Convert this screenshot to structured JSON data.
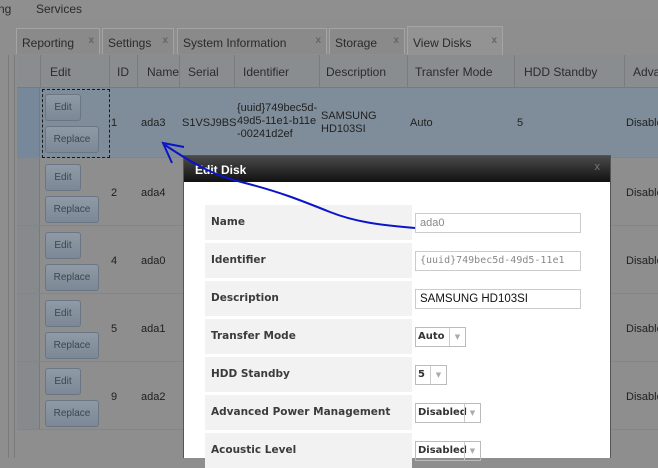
{
  "menu": {
    "partial": "ng",
    "services": "Services"
  },
  "tabs": [
    {
      "label": "Reporting"
    },
    {
      "label": "Settings"
    },
    {
      "label": "System Information"
    },
    {
      "label": "Storage"
    },
    {
      "label": "View Disks"
    }
  ],
  "tab_close": "x",
  "columns": [
    "Edit",
    "ID",
    "Name",
    "Serial",
    "Identifier",
    "Description",
    "Transfer Mode",
    "HDD Standby",
    "Advan"
  ],
  "buttons": {
    "edit": "Edit",
    "replace": "Replace"
  },
  "rows": [
    {
      "id": "1",
      "name": "ada3",
      "serial": "S1VSJ9BS",
      "identifier": "{uuid}749bec5d-49d5-11e1-b11e-00241d2ef",
      "description": "SAMSUNG HD103SI",
      "transfer": "Auto",
      "standby": "5",
      "apm": "Disabled"
    },
    {
      "id": "2",
      "name": "ada4",
      "apm": "Disabled"
    },
    {
      "id": "4",
      "name": "ada0",
      "apm": "Disabled"
    },
    {
      "id": "5",
      "name": "ada1",
      "apm": "Disabled"
    },
    {
      "id": "9",
      "name": "ada2",
      "apm": "Disabled"
    }
  ],
  "modal": {
    "title": "Edit Disk",
    "close": "x",
    "fields": [
      {
        "label": "Name",
        "value": "ada0"
      },
      {
        "label": "Identifier",
        "value": "{uuid}749bec5d-49d5-11e1"
      },
      {
        "label": "Description",
        "value": "SAMSUNG HD103SI"
      },
      {
        "label": "Transfer Mode",
        "value": "Auto"
      },
      {
        "label": "HDD Standby",
        "value": "5"
      },
      {
        "label": "Advanced Power Management",
        "value": "Disabled"
      },
      {
        "label": "Acoustic Level",
        "value": "Disabled"
      }
    ]
  },
  "colors": {
    "annotation": "#0a14c8",
    "overlay": "#8e8e8e"
  }
}
